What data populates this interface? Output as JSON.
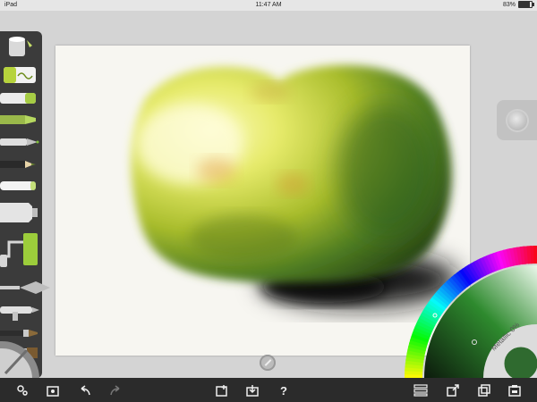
{
  "status_bar": {
    "device": "iPad",
    "time": "11:47 AM",
    "battery_text": "83%",
    "battery_level": 0.83
  },
  "tool_rail": {
    "tools": [
      {
        "name": "paint-pot-icon"
      },
      {
        "name": "sample-swatch-icon"
      },
      {
        "name": "eraser-icon"
      },
      {
        "name": "marker-icon"
      },
      {
        "name": "ink-pen-icon"
      },
      {
        "name": "pencil-icon"
      },
      {
        "name": "chalk-icon"
      },
      {
        "name": "paint-tube-icon"
      },
      {
        "name": "paint-roller-icon"
      },
      {
        "name": "palette-knife-icon"
      },
      {
        "name": "airbrush-icon"
      },
      {
        "name": "brush-icon"
      },
      {
        "name": "flat-brush-icon"
      },
      {
        "name": "tool-settings-dial-icon"
      }
    ]
  },
  "color_picker": {
    "metallic_label": "Metallic 0%",
    "current_color": "#2f6a2f"
  },
  "bottom_toolbar": {
    "help_label": "?",
    "buttons": [
      {
        "name": "settings-gear-icon"
      },
      {
        "name": "gallery-icon"
      },
      {
        "name": "undo-icon"
      },
      {
        "name": "redo-icon"
      },
      {
        "name": "new-canvas-icon"
      },
      {
        "name": "import-icon"
      },
      {
        "name": "help-icon"
      },
      {
        "name": "layers-icon"
      },
      {
        "name": "export-icon"
      },
      {
        "name": "duplicate-icon"
      },
      {
        "name": "tracing-icon"
      }
    ]
  },
  "colors": {
    "apple_light": "#f3f27a",
    "apple_mid": "#b7c530",
    "apple_dark": "#3e6b1e",
    "shadow": "#1a1a1a",
    "canvas": "#f7f6f1"
  }
}
